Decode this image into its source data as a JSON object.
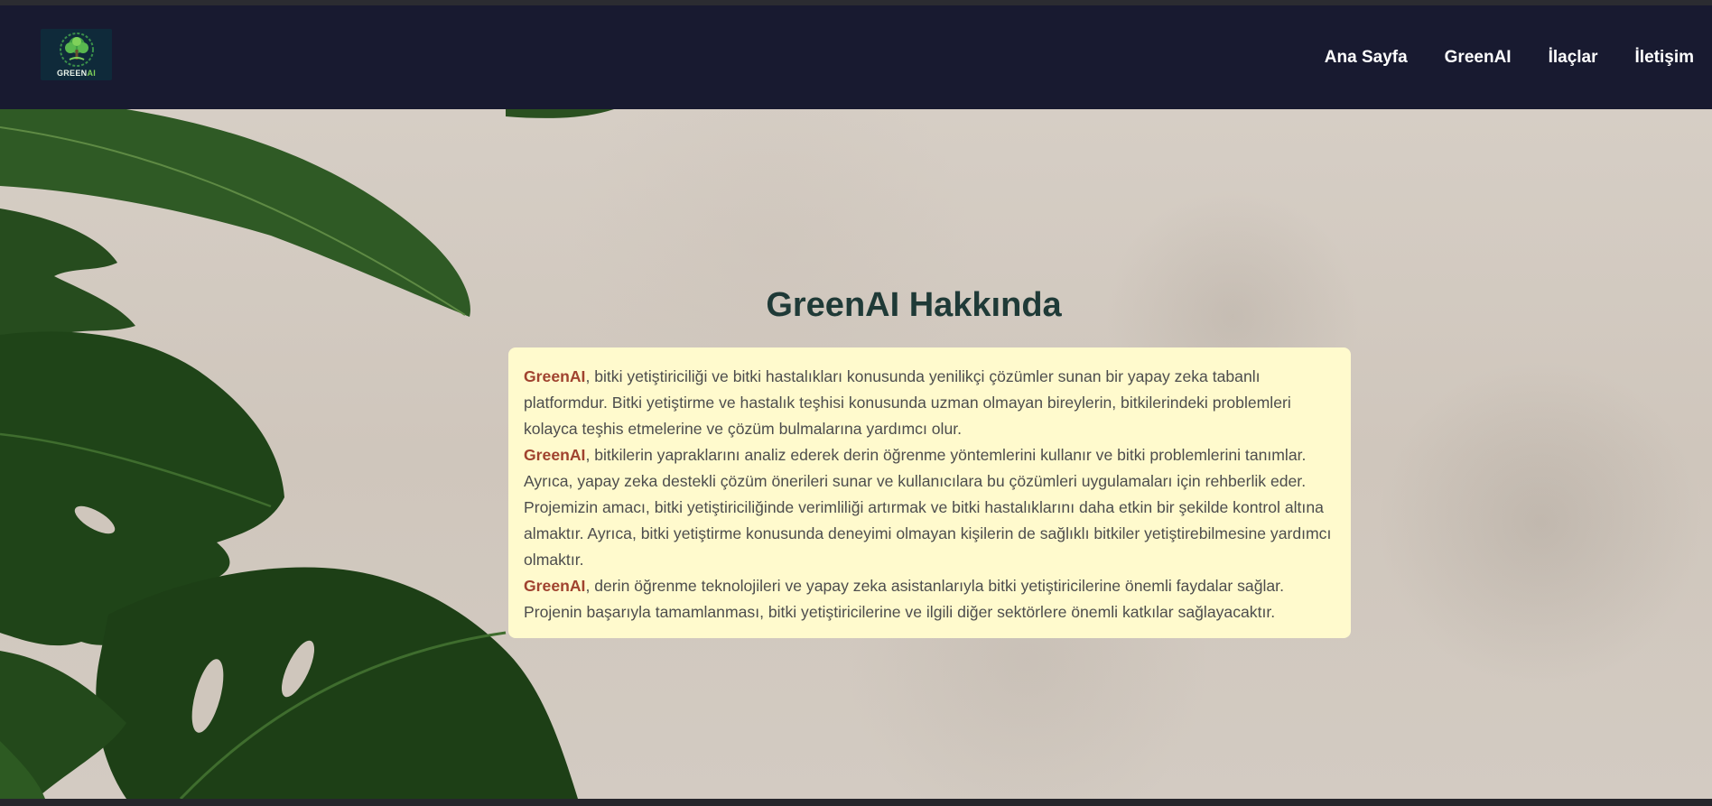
{
  "navbar": {
    "logo_label_green": "GREEN",
    "logo_label_ai": "AI",
    "links": [
      "Ana Sayfa",
      "GreenAI",
      "İlaçlar",
      "İletişim"
    ]
  },
  "main": {
    "title": "GreenAI Hakkında",
    "brand": "GreenAI",
    "p1_rest": ", bitki yetiştiriciliği ve bitki hastalıkları konusunda yenilikçi çözümler sunan bir yapay zeka tabanlı platformdur. Bitki yetiştirme ve hastalık teşhisi konusunda uzman olmayan bireylerin, bitkilerindeki problemleri kolayca teşhis etmelerine ve çözüm bulmalarına yardımcı olur.",
    "p2_rest": ", bitkilerin yapraklarını analiz ederek derin öğrenme yöntemlerini kullanır ve bitki problemlerini tanımlar. Ayrıca, yapay zeka destekli çözüm önerileri sunar ve kullanıcılara bu çözümleri uygulamaları için rehberlik eder. Projemizin amacı, bitki yetiştiriciliğinde verimliliği artırmak ve bitki hastalıklarını daha etkin bir şekilde kontrol altına almaktır. Ayrıca, bitki yetiştirme konusunda deneyimi olmayan kişilerin de sağlıklı bitkiler yetiştirebilmesine yardımcı olmaktır.",
    "p3_rest": ", derin öğrenme teknolojileri ve yapay zeka asistanlarıyla bitki yetiştiricilerine önemli faydalar sağlar. Projenin başarıyla tamamlanması, bitki yetiştiricilerine ve ilgili diğer sektörlere önemli katkılar sağlayacaktır."
  },
  "colors": {
    "navbar_bg": "#181a30",
    "box_bg": "#fffacd",
    "brand_accent": "#a0432f",
    "title": "#1f3a37"
  },
  "icons": {
    "logo": "tree-logo-icon"
  }
}
